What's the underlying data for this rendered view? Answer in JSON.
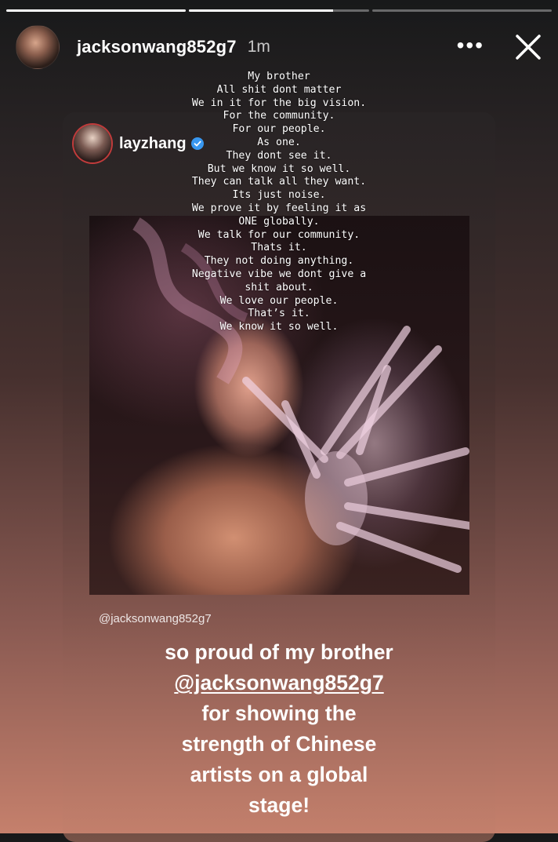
{
  "progress": [
    1.0,
    0.8,
    0.0
  ],
  "header": {
    "username": "jacksonwang852g7",
    "time": "1m",
    "more_icon": "more-icon",
    "close_icon": "close-icon"
  },
  "card": {
    "username": "layzhang",
    "verified_icon": "verified-badge-icon"
  },
  "poem": [
    "My brother",
    "All shit dont matter",
    "We in it for the big vision.",
    "For the community.",
    "For our people.",
    "As one.",
    "They dont see it.",
    "But we know it so well.",
    "They can talk all they want.",
    "Its just noise.",
    "We prove it by feeling it as",
    "ONE globally.",
    "We talk for our community.",
    "Thats it.",
    "They not doing anything.",
    "Negative vibe we dont give a",
    "shit about.",
    "We love our people.",
    "That’s it.",
    "We know it so well."
  ],
  "mention_small": "@jacksonwang852g7",
  "caption": [
    "so proud of my brother",
    "@jacksonwang852g7",
    "for showing the",
    "strength of Chinese",
    "artists on a global",
    "stage!"
  ]
}
